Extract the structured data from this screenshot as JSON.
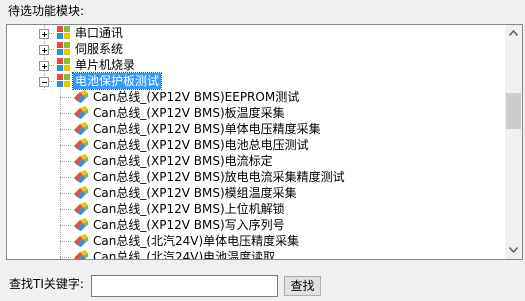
{
  "header": {
    "label": "待选功能模块:"
  },
  "tree": {
    "items": [
      {
        "label": "串口通讯",
        "type": "group",
        "expanded": false
      },
      {
        "label": "伺服系统",
        "type": "group",
        "expanded": false
      },
      {
        "label": "单片机烧录",
        "type": "group",
        "expanded": false
      },
      {
        "label": "电池保护板测试",
        "type": "group",
        "expanded": true,
        "selected": true
      },
      {
        "label": "Can总线_(XP12V BMS)EEPROM测试",
        "type": "test"
      },
      {
        "label": "Can总线_(XP12V BMS)板温度采集",
        "type": "test"
      },
      {
        "label": "Can总线_(XP12V BMS)单体电压精度采集",
        "type": "test"
      },
      {
        "label": "Can总线_(XP12V BMS)电池总电压测试",
        "type": "test"
      },
      {
        "label": "Can总线_(XP12V BMS)电流标定",
        "type": "test"
      },
      {
        "label": "Can总线_(XP12V BMS)放电电流采集精度测试",
        "type": "test"
      },
      {
        "label": "Can总线_(XP12V BMS)模组温度采集",
        "type": "test"
      },
      {
        "label": "Can总线_(XP12V BMS)上位机解锁",
        "type": "test"
      },
      {
        "label": "Can总线_(XP12V BMS)写入序列号",
        "type": "test"
      },
      {
        "label": "Can总线_(北汽24V)单体电压精度采集",
        "type": "test"
      },
      {
        "label": "Can总线_(北汽24V)电池温度读取",
        "type": "test"
      }
    ]
  },
  "search": {
    "label": "查找TI关键字:",
    "value": "",
    "button_label": "查找"
  },
  "icons": {
    "group": "four-color-squares-icon",
    "test": "colorful-test-item-icon",
    "expand": "plus-expander-icon",
    "collapse": "minus-expander-icon"
  },
  "colors": {
    "selection": "#3399ff",
    "group_icon": [
      "#e84a2f",
      "#7cc043",
      "#2f8fe8",
      "#f5c200"
    ]
  }
}
